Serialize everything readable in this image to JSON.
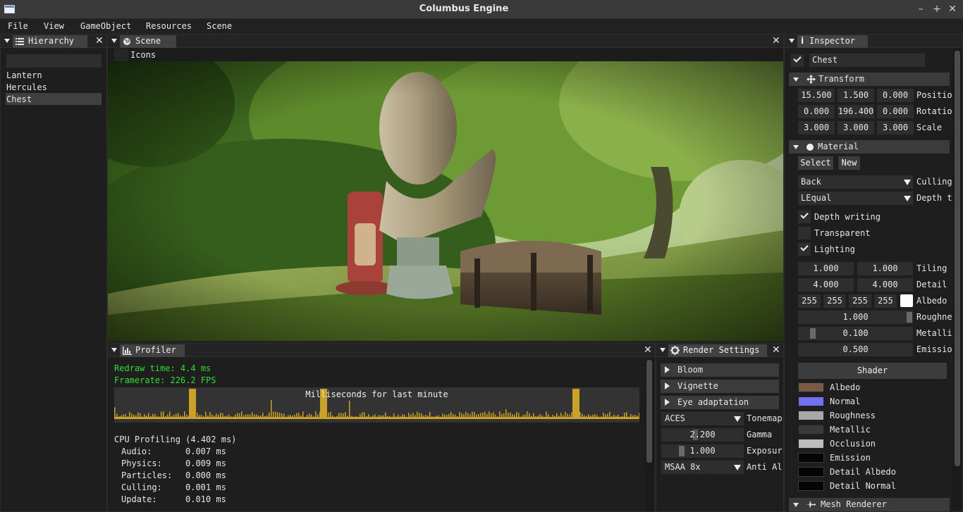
{
  "window": {
    "title": "Columbus Engine"
  },
  "menu": [
    "File",
    "View",
    "GameObject",
    "Resources",
    "Scene"
  ],
  "hierarchy": {
    "tab": "Hierarchy",
    "search_value": "",
    "items": [
      "Lantern",
      "Hercules",
      "Chest"
    ],
    "selected": "Chest"
  },
  "scene": {
    "tab": "Scene",
    "icons_label": "Icons"
  },
  "profiler": {
    "tab": "Profiler",
    "redraw": "Redraw time: 4.4 ms",
    "framerate": "Framerate:   226.2 FPS",
    "graph_title": "Milliseconds for last minute",
    "cpu_title": "CPU Profiling (4.402 ms)",
    "rows": [
      {
        "name": "Audio:",
        "value": "0.007 ms"
      },
      {
        "name": "Physics:",
        "value": "0.009 ms"
      },
      {
        "name": "Particles:",
        "value": "0.000 ms"
      },
      {
        "name": "Culling:",
        "value": "0.001 ms"
      },
      {
        "name": "Update:",
        "value": "0.010 ms"
      }
    ],
    "graph_color": "#c9a227"
  },
  "render_settings": {
    "tab": "Render Settings",
    "sections": [
      "Bloom",
      "Vignette",
      "Eye adaptation"
    ],
    "tonemap": {
      "value": "ACES",
      "label": "Tonemap"
    },
    "gamma": {
      "value": "2.200",
      "label": "Gamma"
    },
    "exposure": {
      "value": "1.000",
      "label": "Exposur"
    },
    "antialias": {
      "value": "MSAA 8x",
      "label": "Anti Al"
    }
  },
  "inspector": {
    "tab": "Inspector",
    "object_name": "Chest",
    "transform": {
      "header": "Transform",
      "position": {
        "label": "Positio",
        "x": "15.500",
        "y": "1.500",
        "z": "0.000"
      },
      "rotation": {
        "label": "Rotatio",
        "x": "0.000",
        "y": "196.400",
        "z": "0.000"
      },
      "scale": {
        "label": "Scale",
        "x": "3.000",
        "y": "3.000",
        "z": "3.000"
      }
    },
    "material": {
      "header": "Material",
      "select_label": "Select",
      "new_label": "New",
      "culling": {
        "value": "Back",
        "label": "Culling"
      },
      "depth_test": {
        "value": "LEqual",
        "label": "Depth t"
      },
      "depth_writing": "Depth writing",
      "transparent": "Transparent",
      "lighting": "Lighting",
      "tiling": {
        "label": "Tiling",
        "x": "1.000",
        "y": "1.000"
      },
      "detail": {
        "label": "Detail",
        "x": "4.000",
        "y": "4.000"
      },
      "albedo": {
        "label": "Albedo",
        "r": "255",
        "g": "255",
        "b": "255",
        "a": "255"
      },
      "roughness": {
        "label": "Roughne",
        "value": "1.000"
      },
      "metallic": {
        "label": "Metalli",
        "value": "0.100"
      },
      "emission": {
        "label": "Emissio",
        "value": "0.500"
      },
      "shader_label": "Shader",
      "textures": [
        "Albedo",
        "Normal",
        "Roughness",
        "Metallic",
        "Occlusion",
        "Emission",
        "Detail Albedo",
        "Detail Normal"
      ]
    },
    "mesh_renderer": "Mesh Renderer"
  }
}
